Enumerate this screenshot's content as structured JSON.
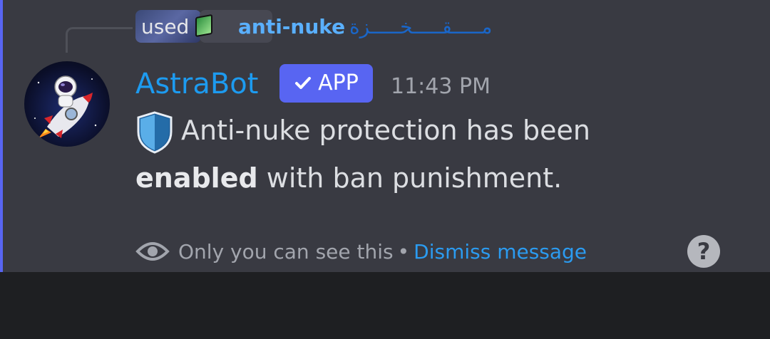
{
  "reply": {
    "used_label": "used",
    "command_prefix": "/",
    "command_name": "anti-nuke",
    "author_text": "مـــــقـــــخـــــزة"
  },
  "message": {
    "author": "AstraBot",
    "badge": "APP",
    "badge_check_icon": "check-icon",
    "timestamp": "11:43 PM",
    "line1": "Anti-nuke protection has been",
    "line2_bold": "enabled",
    "line2_rest": " with ban punishment.",
    "shield_icon": "shield-icon"
  },
  "footer": {
    "eye_icon": "eye-icon",
    "visibility_text": "Only you can see this",
    "separator": "•",
    "dismiss_label": "Dismiss message",
    "help_label": "?"
  },
  "colors": {
    "author": "#1d9bf0",
    "badge_bg": "#5865f2",
    "link": "#2b9bf0",
    "message_bg": "#393a42",
    "page_bg": "#1e1f22"
  }
}
